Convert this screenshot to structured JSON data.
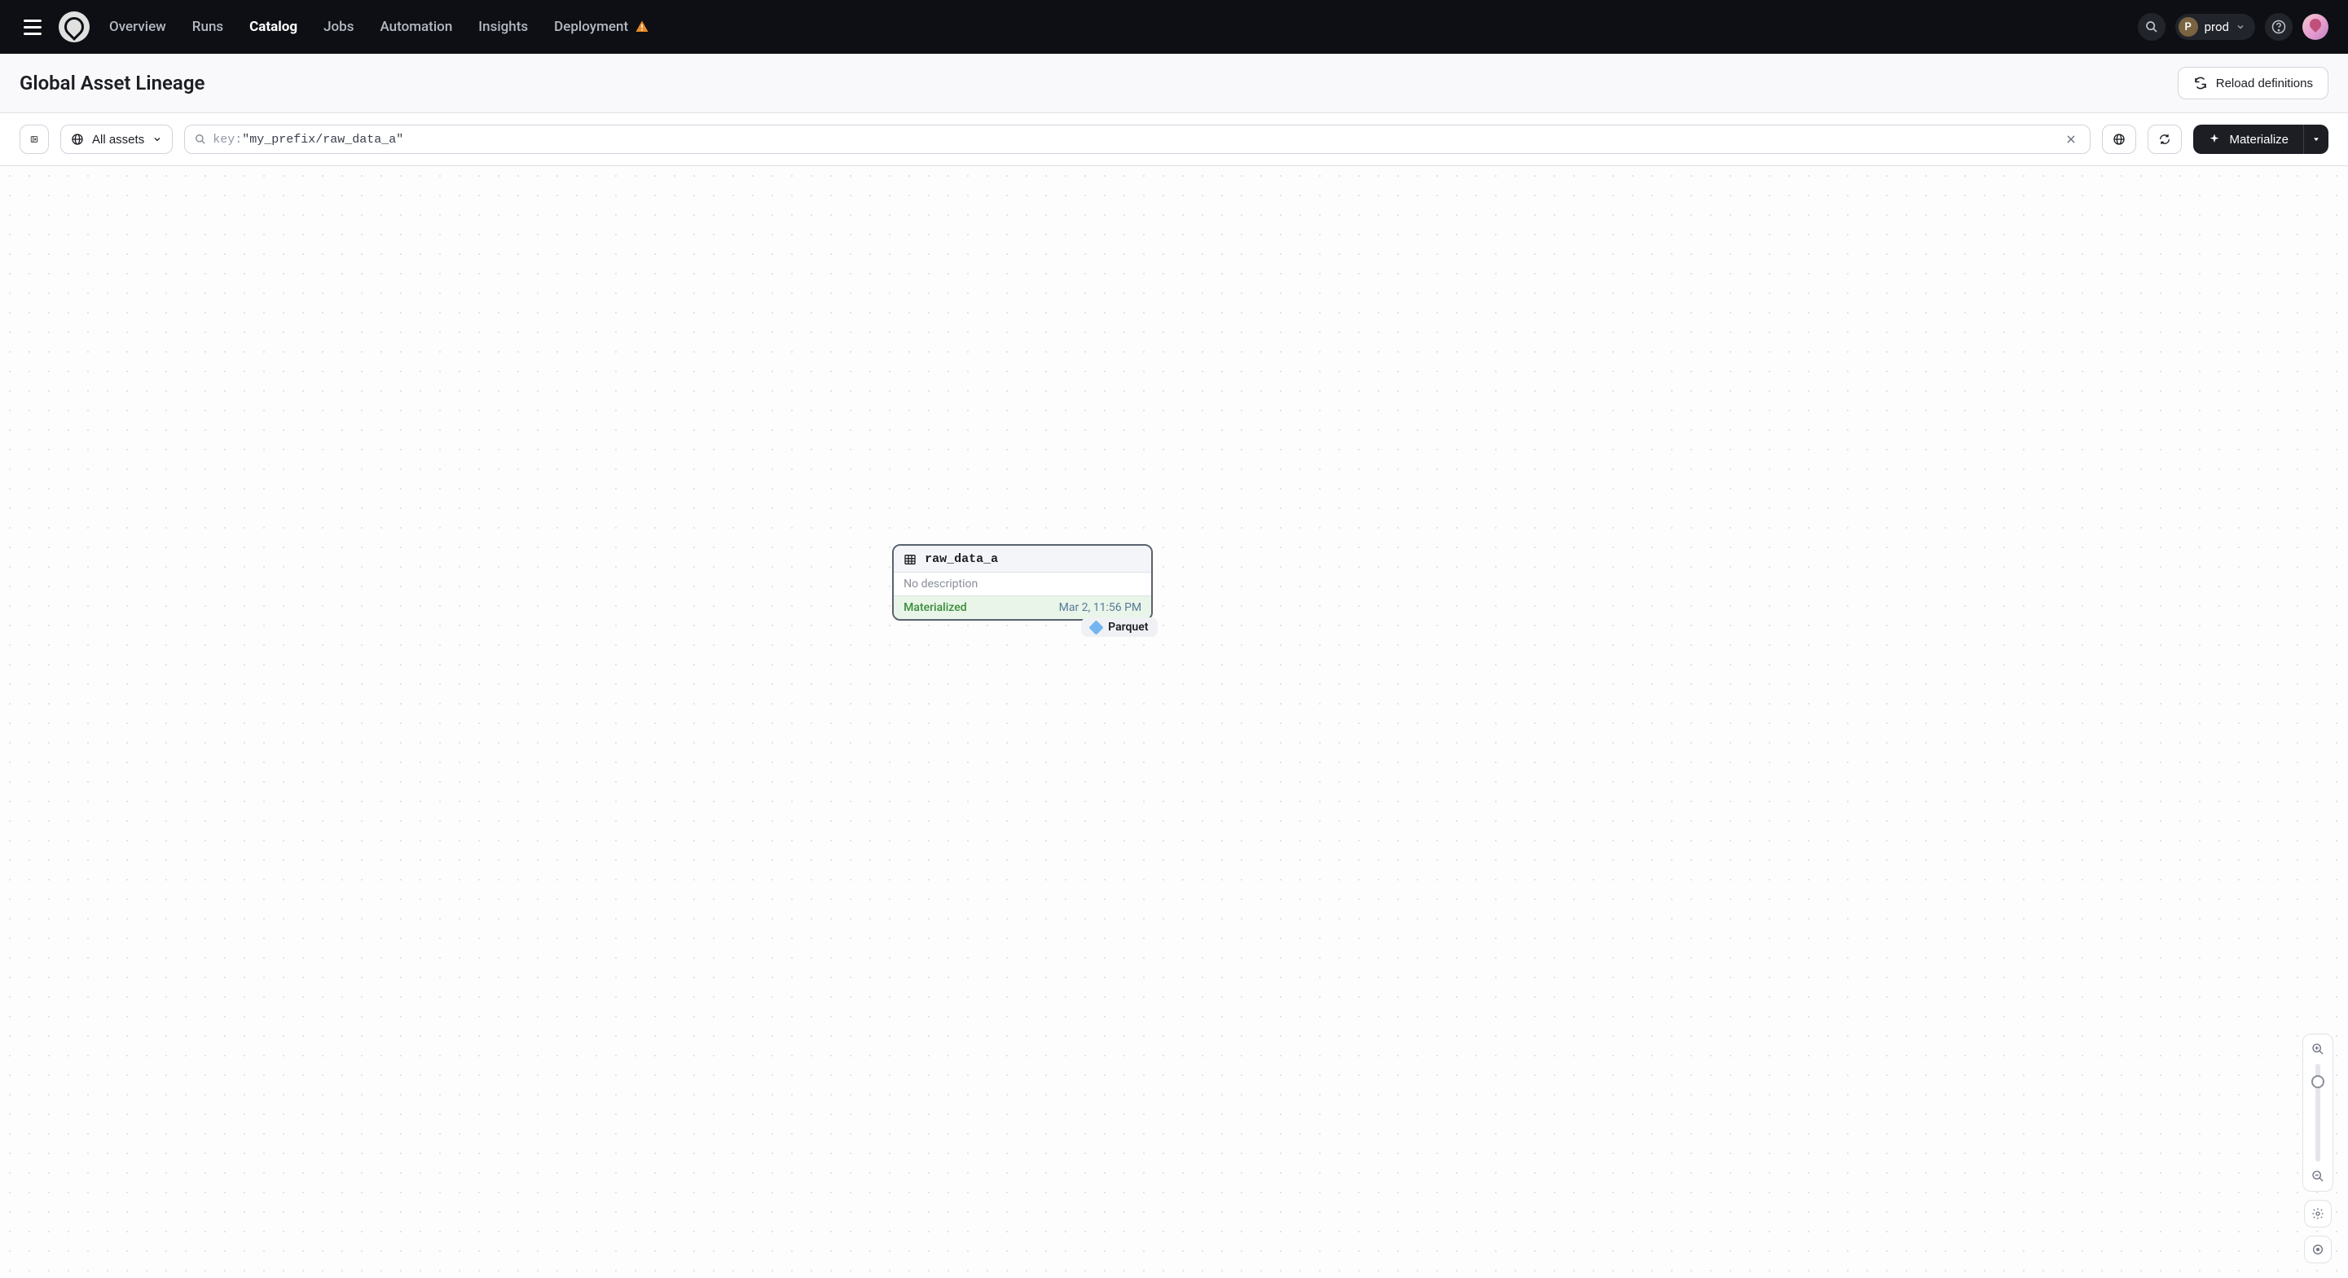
{
  "nav": {
    "items": [
      "Overview",
      "Runs",
      "Catalog",
      "Jobs",
      "Automation",
      "Insights",
      "Deployment"
    ],
    "active": "Catalog",
    "deployment": {
      "badge": "P",
      "label": "prod"
    }
  },
  "subheader": {
    "title": "Global Asset Lineage",
    "reload_label": "Reload definitions"
  },
  "filter": {
    "all_assets_label": "All assets",
    "search_key": "key:",
    "search_value": "\"my_prefix/raw_data_a\"",
    "materialize_label": "Materialize"
  },
  "asset": {
    "name": "raw_data_a",
    "desc": "No description",
    "status": "Materialized",
    "timestamp": "Mar 2, 11:56 PM",
    "tag": "Parquet"
  }
}
